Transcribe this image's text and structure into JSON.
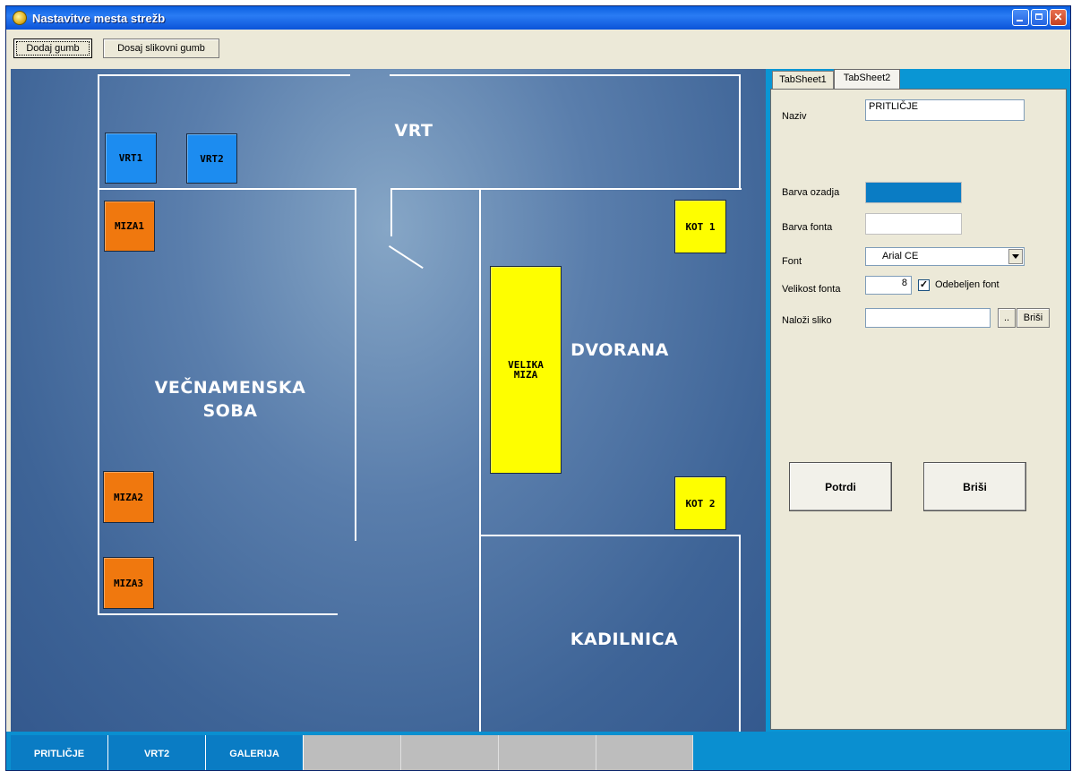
{
  "window": {
    "title": "Nastavitve mesta strežb"
  },
  "toolbar": {
    "add_button": "Dodaj gumb",
    "add_image_button": "Dosaj slikovni gumb"
  },
  "floorplan": {
    "tables": {
      "vrt1": "VRT1",
      "vrt2": "VRT2",
      "miza1": "MIZA1",
      "miza2": "MIZA2",
      "miza3": "MIZA3",
      "kot1": "KOT 1",
      "kot2": "KOT 2",
      "velika_miza": "VELIKA\nMIZA"
    },
    "rooms": {
      "vrt": "VRT",
      "vecnamenska": "VEČNAMENSKA\nSOBA",
      "dvorana": "DVORANA",
      "kadilnica": "KADILNICA"
    }
  },
  "tabs": [
    "TabSheet1",
    "TabSheet2"
  ],
  "form": {
    "naziv_label": "Naziv",
    "naziv_value": "PRITLIČJE",
    "bg_color_label": "Barva ozadja",
    "bg_color": "#0a7cc4",
    "font_color_label": "Barva fonta",
    "font_color": "#ffffff",
    "font_label": "Font",
    "font_value": "Arial CE",
    "font_size_label": "Velikost fonta",
    "font_size_value": "8",
    "bold_label": "Odebeljen font",
    "bold_checked": "✓",
    "image_label": "Naloži sliko",
    "browse_button": "..",
    "clear_image_button": "Briši",
    "confirm_button": "Potrdi",
    "delete_button": "Briši"
  },
  "floor_tabs": [
    "PRITLIČJE",
    "VRT2",
    "GALERIJA"
  ]
}
